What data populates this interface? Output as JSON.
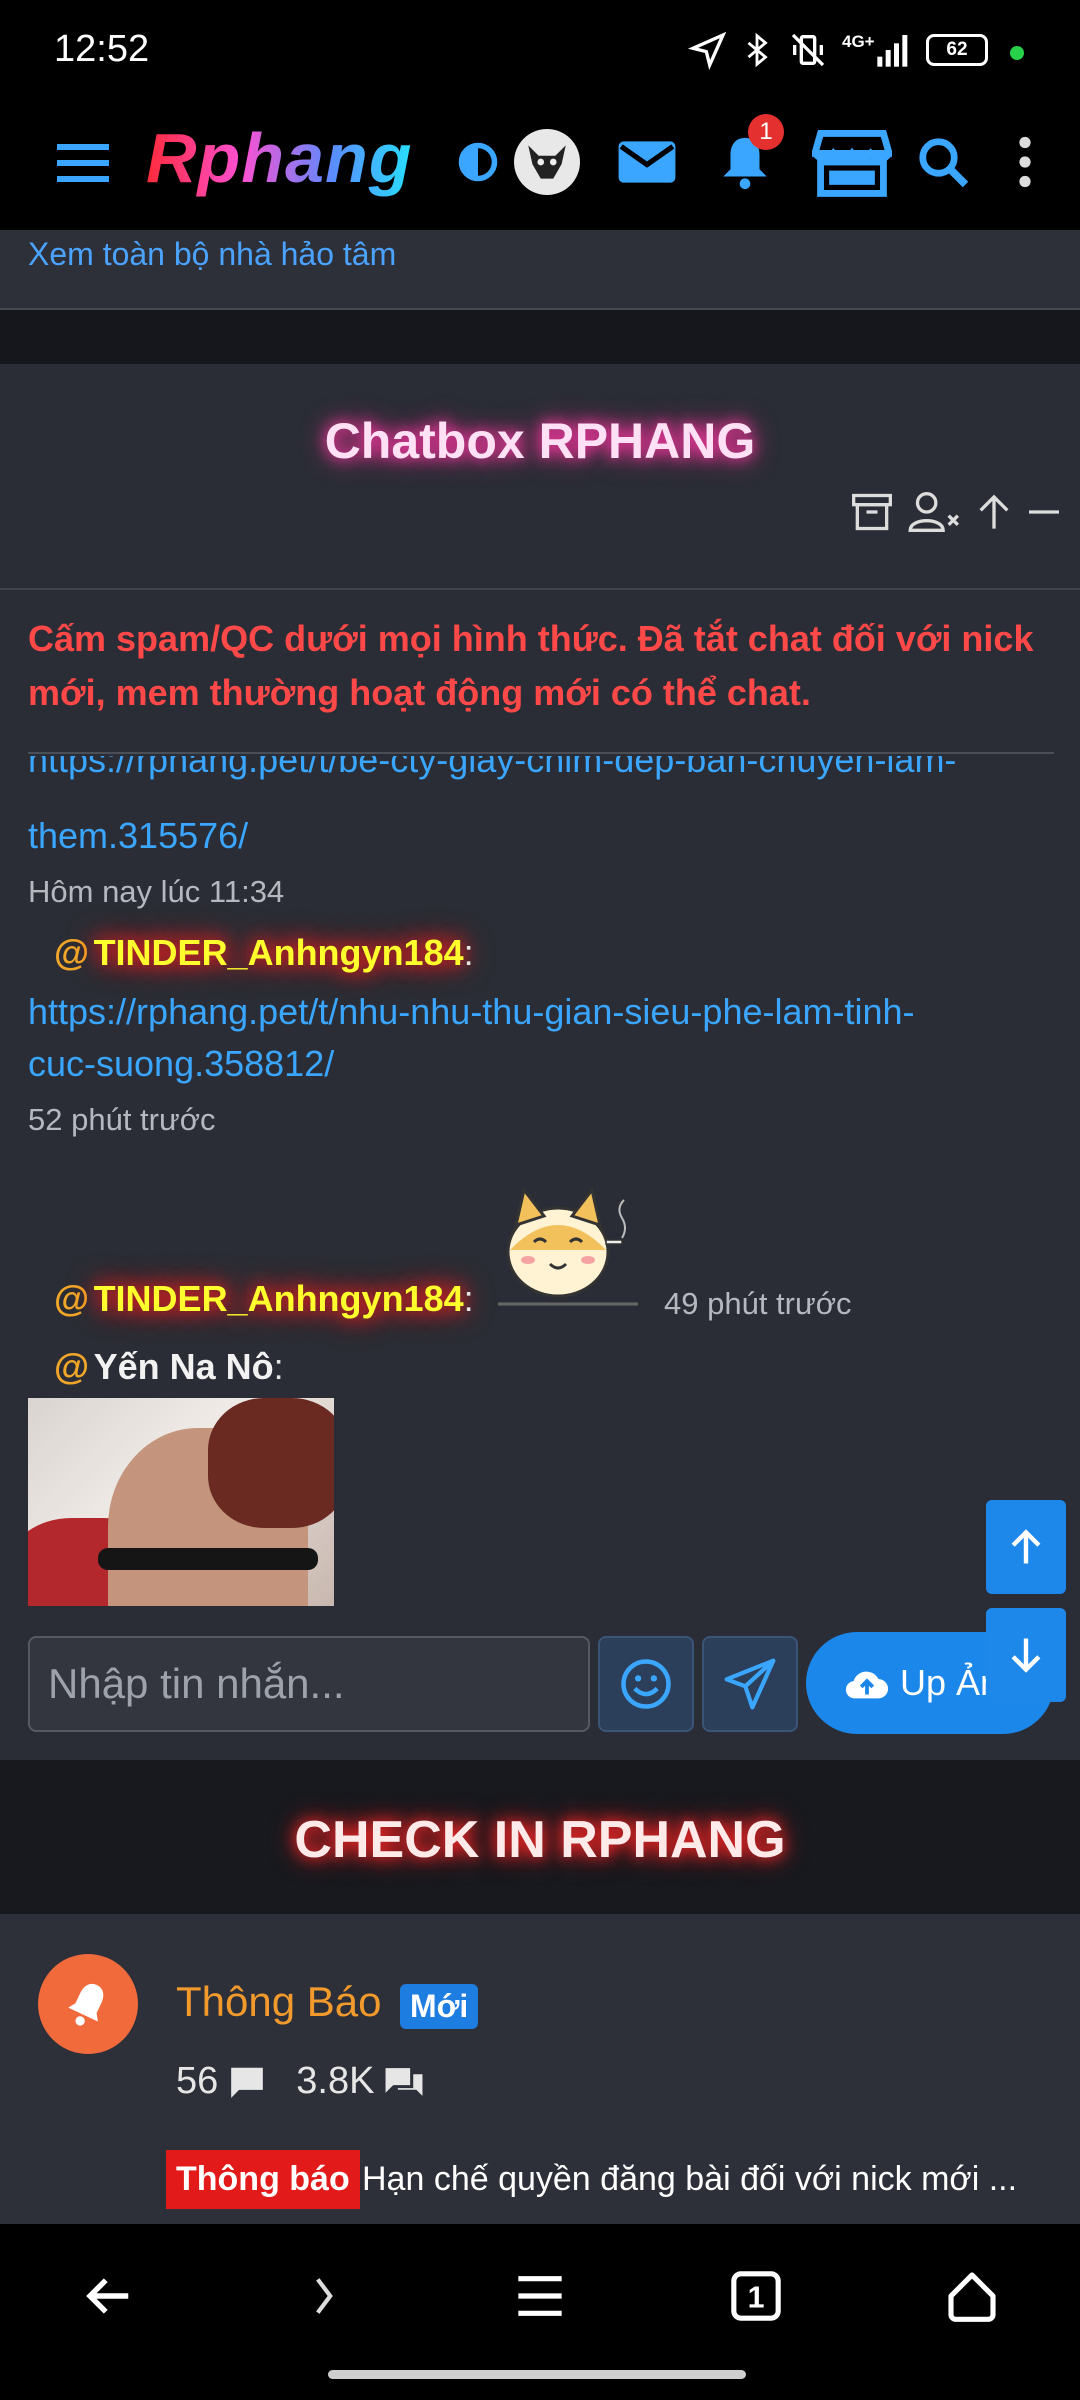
{
  "status_bar": {
    "time": "12:52",
    "network": "4G+",
    "battery": "62"
  },
  "nav": {
    "logo": "Rphang",
    "notification_count": "1"
  },
  "donor_link": "Xem toàn bộ nhà hảo tâm",
  "chatbox": {
    "title": "Chatbox RPHANG",
    "rules": "Cấm spam/QC dưới mọi hình thức. Đã tắt chat đối với nick mới, mem thường hoạt động mới có thể chat.",
    "messages": [
      {
        "link_partial": "https://rphang.pet/t/be-cty-giay-chim-dep-ban-chuyen-lam-",
        "link_tail": "them.315576/",
        "time": "Hôm nay lúc 11:34"
      },
      {
        "at": "@",
        "user": "TINDER_Anhngyn184",
        "sep": ":",
        "link_line1": "https://rphang.pet/t/nhu-nhu-thu-gian-sieu-phe-lam-tinh-",
        "link_line2": "cuc-suong.358812/",
        "time": "52 phút trước"
      },
      {
        "at": "@",
        "user": "TINDER_Anhngyn184",
        "sep": ":",
        "time": "49 phút trước"
      },
      {
        "at": "@",
        "user": "Yến Na Nô",
        "sep": ":"
      }
    ],
    "input_placeholder": "Nhập tin nhắn...",
    "upload_label": "Up Ảnh"
  },
  "checkin": {
    "title": "CHECK IN RPHANG"
  },
  "forum": {
    "name": "Thông Báo",
    "badge": "Mới",
    "threads": "56",
    "posts": "3.8K",
    "notice_tag": "Thông báo",
    "notice_text": "Hạn chế quyền đăng bài đối với nick mới ..."
  },
  "colors": {
    "accent_blue": "#1b87ea",
    "rule_red": "#ff4848",
    "nick_yellow": "#ffff2d",
    "forum_orange": "#f39a2c"
  }
}
